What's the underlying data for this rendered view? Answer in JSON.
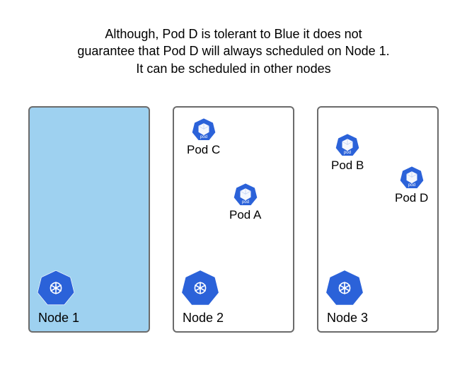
{
  "caption": {
    "line1": "Although, Pod D is tolerant to Blue it does not",
    "line2": "guarantee that Pod D will always scheduled on Node 1.",
    "line3": "It can be scheduled in other nodes"
  },
  "taint_color": "#9ed1f0",
  "nodes": [
    {
      "id": "node-1",
      "label": "Node 1",
      "tainted": true,
      "pods": []
    },
    {
      "id": "node-2",
      "label": "Node 2",
      "tainted": false,
      "pods": [
        {
          "id": "pod-c",
          "label": "Pod C"
        },
        {
          "id": "pod-a",
          "label": "Pod A"
        }
      ]
    },
    {
      "id": "node-3",
      "label": "Node 3",
      "tainted": false,
      "pods": [
        {
          "id": "pod-b",
          "label": "Pod B"
        },
        {
          "id": "pod-d",
          "label": "Pod D"
        }
      ]
    }
  ],
  "icons": {
    "node": "k8s-node-icon",
    "pod": "k8s-pod-icon",
    "pod_badge": "pod"
  }
}
